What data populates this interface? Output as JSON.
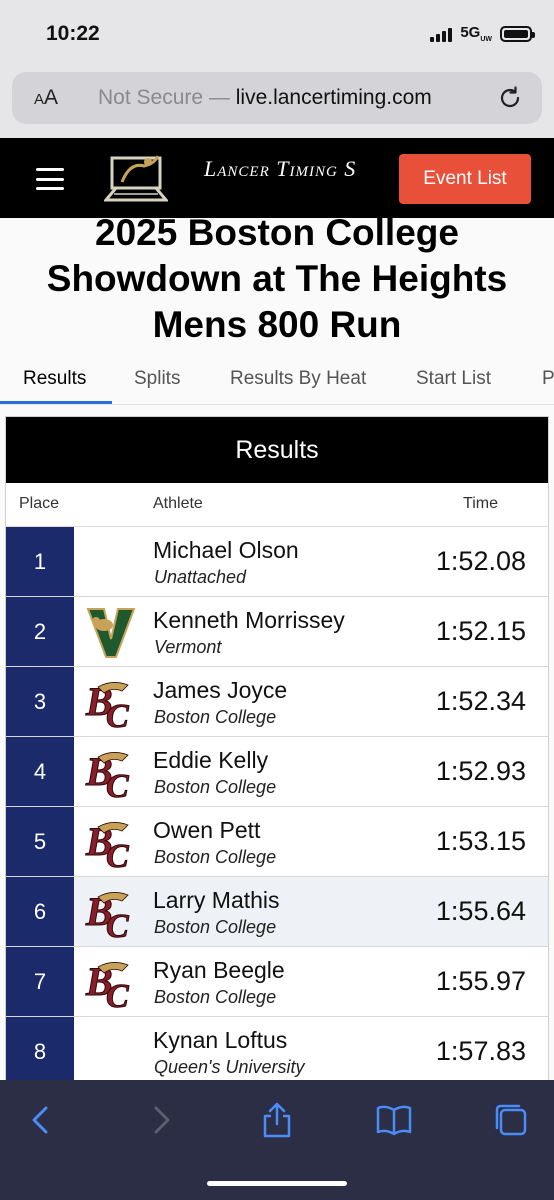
{
  "status_bar": {
    "time": "10:22",
    "network": "5G",
    "network_suffix": "UW"
  },
  "browser": {
    "text_size_label": "AA",
    "url_prefix": "Not Secure —",
    "url_domain": "live.lancertiming.com"
  },
  "site_header": {
    "logo_text": "Lancer Timing S",
    "event_list_label": "Event List",
    "accent_color": "#e8503a"
  },
  "page": {
    "title_line1": "2025 Boston College",
    "title_line2": "Showdown at The Heights",
    "title_line3": "Mens 800 Run"
  },
  "tabs": [
    {
      "label": "Results",
      "active": true
    },
    {
      "label": "Splits",
      "active": false
    },
    {
      "label": "Results By Heat",
      "active": false
    },
    {
      "label": "Start List",
      "active": false
    },
    {
      "label": "P",
      "active": false
    }
  ],
  "results": {
    "header": "Results",
    "columns": {
      "place": "Place",
      "athlete": "Athlete",
      "time": "Time"
    },
    "rows": [
      {
        "place": "1",
        "name": "Michael Olson",
        "team": "Unattached",
        "time": "1:52.08",
        "logo": "none"
      },
      {
        "place": "2",
        "name": "Kenneth Morrissey",
        "team": "Vermont",
        "time": "1:52.15",
        "logo": "vermont-logo"
      },
      {
        "place": "3",
        "name": "James Joyce",
        "team": "Boston College",
        "time": "1:52.34",
        "logo": "boston-college-logo"
      },
      {
        "place": "4",
        "name": "Eddie Kelly",
        "team": "Boston College",
        "time": "1:52.93",
        "logo": "boston-college-logo"
      },
      {
        "place": "5",
        "name": "Owen Pett",
        "team": "Boston College",
        "time": "1:53.15",
        "logo": "boston-college-logo"
      },
      {
        "place": "6",
        "name": "Larry Mathis",
        "team": "Boston College",
        "time": "1:55.64",
        "logo": "boston-college-logo"
      },
      {
        "place": "7",
        "name": "Ryan Beegle",
        "team": "Boston College",
        "time": "1:55.97",
        "logo": "boston-college-logo"
      },
      {
        "place": "8",
        "name": "Kynan Loftus",
        "team": "Queen's University",
        "time": "1:57.83",
        "logo": "none"
      }
    ]
  },
  "colors": {
    "place_bg": "#1b2a6b",
    "header_bg": "#000000",
    "toolbar_bg": "#2b2e45",
    "icon_blue": "#4b8df8"
  }
}
